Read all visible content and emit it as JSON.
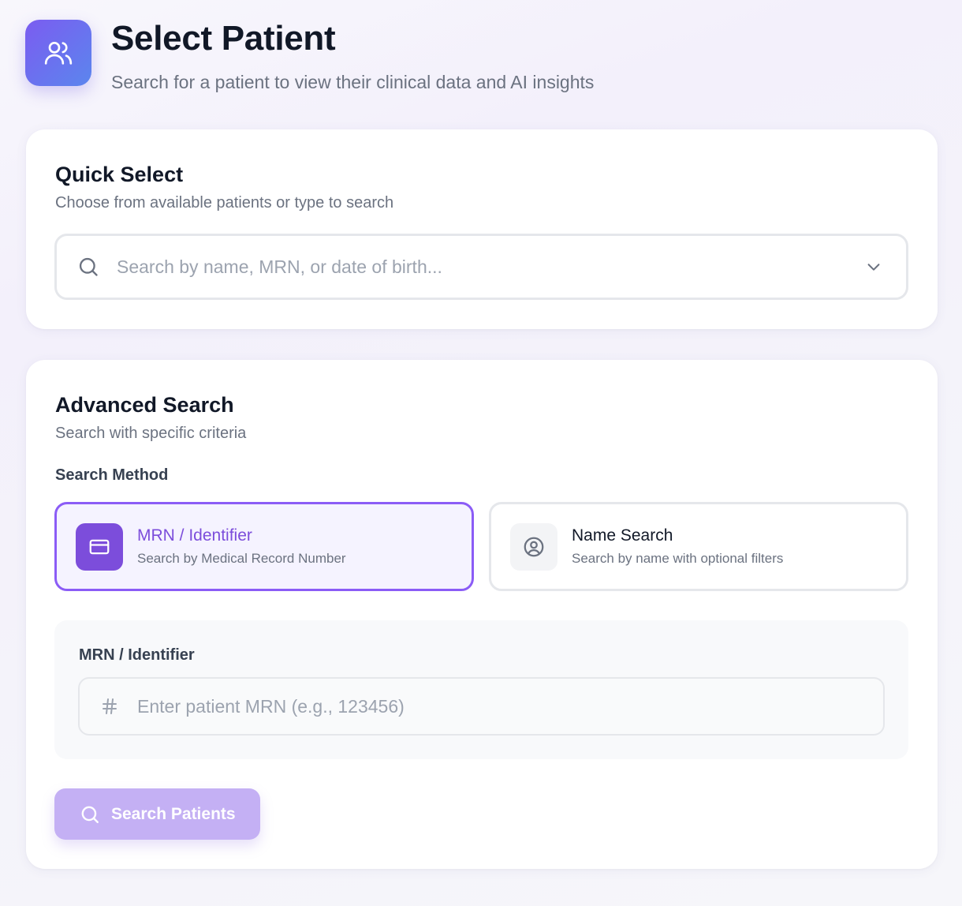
{
  "header": {
    "icon": "users-icon",
    "title": "Select Patient",
    "subtitle": "Search for a patient to view their clinical data and AI insights"
  },
  "quick_select": {
    "title": "Quick Select",
    "description": "Choose from available patients or type to search",
    "combobox": {
      "placeholder": "Search by name, MRN, or date of birth...",
      "value": "",
      "icon": "search-icon",
      "toggle_icon": "chevron-down-icon"
    }
  },
  "advanced_search": {
    "title": "Advanced Search",
    "description": "Search with specific criteria",
    "method_label": "Search Method",
    "methods": [
      {
        "title": "MRN / Identifier",
        "subtitle": "Search by Medical Record Number",
        "icon": "id-card-icon",
        "selected": true
      },
      {
        "title": "Name Search",
        "subtitle": "Search by name with optional filters",
        "icon": "user-circle-icon",
        "selected": false
      }
    ],
    "mrn_field": {
      "label": "MRN / Identifier",
      "placeholder": "Enter patient MRN (e.g., 123456)",
      "value": "",
      "icon": "hash-icon"
    },
    "search_button": {
      "label": "Search Patients",
      "icon": "search-icon",
      "disabled": true
    }
  },
  "colors": {
    "accent": "#7c4ddb",
    "accent_border": "#8b5cf6",
    "selected_bg": "#f5f3ff",
    "button_disabled": "#c4b0f4"
  }
}
